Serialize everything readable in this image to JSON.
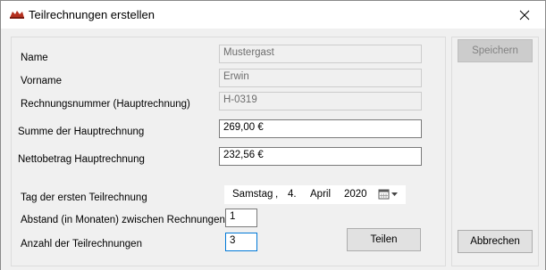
{
  "window": {
    "title": "Teilrechnungen erstellen"
  },
  "form": {
    "name_label": "Name",
    "name_value": "Mustergast",
    "vorname_label": "Vorname",
    "vorname_value": "Erwin",
    "rechnungsnummer_label": "Rechnungsnummer (Hauptrechnung)",
    "rechnungsnummer_value": "H-0319",
    "summe_label": "Summe der Hauptrechnung",
    "summe_value": "269,00 €",
    "netto_label": "Nettobetrag Hauptrechnung",
    "netto_value": "232,56 €",
    "tag_label": "Tag der ersten Teilrechnung",
    "date": {
      "weekday": "Samstag",
      "sep": ",",
      "day": "4.",
      "month": "April",
      "year": "2020"
    },
    "abstand_label": "Abstand (in Monaten) zwischen Rechnungen",
    "abstand_value": "1",
    "anzahl_label": "Anzahl der Teilrechnungen",
    "anzahl_value": "3"
  },
  "buttons": {
    "teilen": "Teilen",
    "speichern": "Speichern",
    "abbrechen": "Abbrechen"
  },
  "icons": {
    "app": "app-logo-icon",
    "close": "close-icon",
    "calendar": "calendar-icon",
    "dropdown": "chevron-down-icon"
  },
  "colors": {
    "focus_border": "#0078d7",
    "disabled_button": "#cccccc"
  }
}
